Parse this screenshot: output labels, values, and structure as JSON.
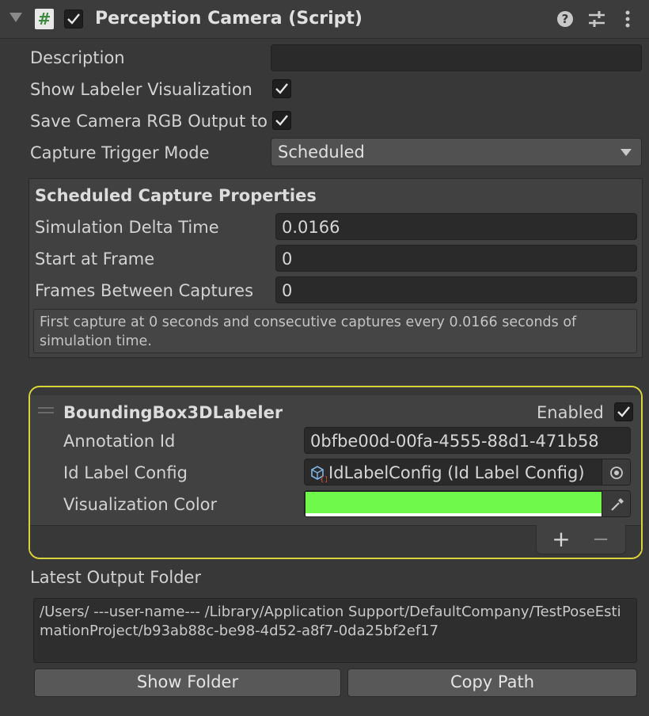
{
  "header": {
    "title": "Perception Camera (Script)",
    "script_icon_glyph": "#",
    "enabled": true,
    "icons": [
      "help-icon",
      "presets-icon",
      "more-icon"
    ]
  },
  "fields": {
    "description_label": "Description",
    "description_value": "",
    "show_labeler_label": "Show Labeler Visualization",
    "show_labeler_checked": true,
    "save_rgb_label": "Save Camera RGB Output to Disk",
    "save_rgb_checked": true,
    "trigger_mode_label": "Capture Trigger Mode",
    "trigger_mode_value": "Scheduled"
  },
  "scheduled": {
    "title": "Scheduled Capture Properties",
    "delta_label": "Simulation Delta Time",
    "delta_value": "0.0166",
    "start_label": "Start at Frame",
    "start_value": "0",
    "between_label": "Frames Between Captures",
    "between_value": "0",
    "info": "First capture at 0 seconds and consecutive captures every 0.0166 seconds of simulation time."
  },
  "labeler": {
    "name": "BoundingBox3DLabeler",
    "enabled_label": "Enabled",
    "enabled": true,
    "annotation_id_label": "Annotation Id",
    "annotation_id_value": "0bfbe00d-00fa-4555-88d1-471b58",
    "id_label_config_label": "Id Label Config",
    "id_label_config_value": "IdLabelConfig (Id Label Config)",
    "viz_color_label": "Visualization Color",
    "viz_color": "#6ff94a",
    "add_glyph": "+",
    "remove_glyph": "−",
    "highlight_color": "#d9d33a"
  },
  "output": {
    "label": "Latest Output Folder",
    "path": "/Users/ ---user-name--- /Library/Application Support/DefaultCompany/TestPoseEstimationProject/b93ab88c-be98-4d52-a8f7-0da25bf2ef17",
    "show_folder": "Show Folder",
    "copy_path": "Copy Path"
  }
}
